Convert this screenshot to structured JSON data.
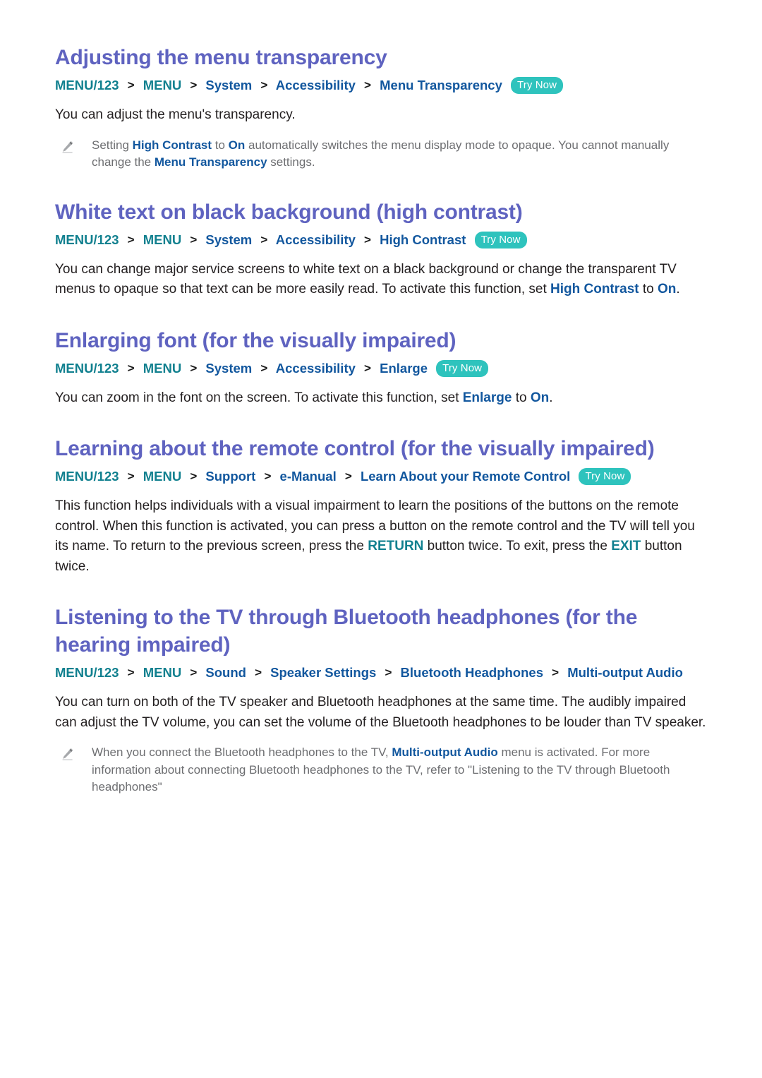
{
  "document": {
    "type": "e-manual-page",
    "background_color": "#ffffff",
    "colors": {
      "heading": "#5f63c0",
      "crumb_teal": "#11808f",
      "crumb_blue": "#12579e",
      "body_text": "#231f20",
      "note_text": "#6d6e71",
      "try_now_badge_bg": "#2ec3bd",
      "try_now_badge_text": "#ffffff",
      "separator": "#1a1a1a"
    },
    "icons": {
      "pencil": "pencil-icon",
      "chevron": "chevron-right-separator"
    }
  },
  "sections": [
    {
      "id": "menu-transparency",
      "title": "Adjusting the menu transparency",
      "breadcrumb": {
        "items": [
          {
            "label": "MENU/123",
            "style": "teal"
          },
          {
            "label": "MENU",
            "style": "teal"
          },
          {
            "label": "System",
            "style": "blue"
          },
          {
            "label": "Accessibility",
            "style": "blue"
          },
          {
            "label": "Menu Transparency",
            "style": "blue"
          }
        ],
        "separator": ">",
        "badge": "Try Now"
      },
      "body": {
        "part1": "You can adjust the menu's transparency."
      },
      "note": {
        "p1": "Setting ",
        "hl1": "High Contrast",
        "p2": " to ",
        "hl2": "On",
        "p3": " automatically switches the menu display mode to opaque. You cannot manually change the ",
        "hl3": "Menu Transparency",
        "p4": " settings."
      }
    },
    {
      "id": "high-contrast",
      "title": "White text on black background (high contrast)",
      "breadcrumb": {
        "items": [
          {
            "label": "MENU/123",
            "style": "teal"
          },
          {
            "label": "MENU",
            "style": "teal"
          },
          {
            "label": "System",
            "style": "blue"
          },
          {
            "label": "Accessibility",
            "style": "blue"
          },
          {
            "label": "High Contrast",
            "style": "blue"
          }
        ],
        "separator": ">",
        "badge": "Try Now"
      },
      "body": {
        "part1": "You can change major service screens to white text on a black background or change the transparent TV menus to opaque so that text can be more easily read. To activate this function, set ",
        "hl1": "High Contrast",
        "part2": " to ",
        "hl2": "On",
        "part3": "."
      }
    },
    {
      "id": "enlarge",
      "title": "Enlarging font (for the visually impaired)",
      "breadcrumb": {
        "items": [
          {
            "label": "MENU/123",
            "style": "teal"
          },
          {
            "label": "MENU",
            "style": "teal"
          },
          {
            "label": "System",
            "style": "blue"
          },
          {
            "label": "Accessibility",
            "style": "blue"
          },
          {
            "label": "Enlarge",
            "style": "blue"
          }
        ],
        "separator": ">",
        "badge": "Try Now"
      },
      "body": {
        "part1": "You can zoom in the font on the screen. To activate this function, set ",
        "hl1": "Enlarge",
        "part2": " to ",
        "hl2": "On",
        "part3": "."
      }
    },
    {
      "id": "learn-remote",
      "title": "Learning about the remote control (for the visually impaired)",
      "breadcrumb": {
        "items": [
          {
            "label": "MENU/123",
            "style": "teal"
          },
          {
            "label": "MENU",
            "style": "teal"
          },
          {
            "label": "Support",
            "style": "blue"
          },
          {
            "label": "e-Manual",
            "style": "blue"
          },
          {
            "label": "Learn About your Remote Control",
            "style": "blue"
          }
        ],
        "separator": ">",
        "badge": "Try Now"
      },
      "body": {
        "part1": "This function helps individuals with a visual impairment to learn the positions of the buttons on the remote control. When this function is activated, you can press a button on the remote control and the TV will tell you its name. To return to the previous screen, press the ",
        "hl1": "RETURN",
        "part2": " button twice. To exit, press the ",
        "hl2": "EXIT",
        "part3": " button twice."
      }
    },
    {
      "id": "bluetooth-headphones",
      "title": "Listening to the TV through Bluetooth headphones (for the hearing impaired)",
      "breadcrumb": {
        "items": [
          {
            "label": "MENU/123",
            "style": "teal"
          },
          {
            "label": "MENU",
            "style": "teal"
          },
          {
            "label": "Sound",
            "style": "blue"
          },
          {
            "label": "Speaker Settings",
            "style": "blue"
          },
          {
            "label": "Bluetooth Headphones",
            "style": "blue"
          },
          {
            "label": "Multi-output Audio",
            "style": "blue"
          }
        ],
        "separator": ">",
        "badge": ""
      },
      "body": {
        "part1": "You can turn on both of the TV speaker and Bluetooth headphones at the same time. The audibly impaired can adjust the TV volume, you can set the volume of the Bluetooth headphones to be louder than TV speaker."
      },
      "note": {
        "p1": "When you connect the Bluetooth headphones to the TV, ",
        "hl1": "Multi-output Audio",
        "p2": " menu is activated. For more information about connecting Bluetooth headphones to the TV, refer to \"Listening to the TV through Bluetooth headphones\""
      }
    }
  ]
}
